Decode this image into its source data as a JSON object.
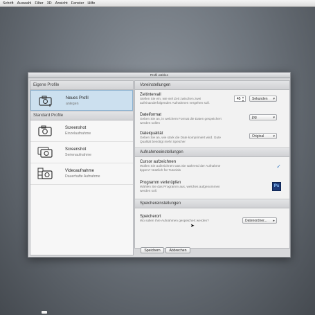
{
  "menu": [
    "Schrift",
    "Auswahl",
    "Filter",
    "3D",
    "Ansicht",
    "Fenster",
    "Hilfe"
  ],
  "dialog": {
    "title": "Profil wählen"
  },
  "left_panel": {
    "own_header": "Eigene Profile",
    "own_items": [
      {
        "title": "Neues Profil",
        "subtitle": "anlegen",
        "icon": "camera-add-icon",
        "selected": true
      }
    ],
    "standard_header": "Standard Profile",
    "standard_items": [
      {
        "title": "Screenshot",
        "subtitle": "Einzelaufnahme",
        "icon": "camera-icon"
      },
      {
        "title": "Screenshot",
        "subtitle": "Serienaufnahme",
        "icon": "camera-stack-icon"
      },
      {
        "title": "Videoaufnahme",
        "subtitle": "Dauerhafte Aufnahme",
        "icon": "video-camera-icon"
      }
    ]
  },
  "right_panel": {
    "sections": {
      "presets": "Voreinstellungen",
      "recording": "Aufnahmeeinstellungen",
      "storage": "Speichereinstellungen"
    },
    "interval": {
      "title": "Zeitintervall",
      "desc": "Stellen Sie ein, wie viel Zeit zwischen zwei aufeinanderfolgenden Aufnahmen vergehen soll.",
      "value": "45",
      "unit": "Sekunden"
    },
    "format": {
      "title": "Dateiformat",
      "desc": "Geben Sie an, in welchem Format die Daten gespeichert werden sollen",
      "value": "jpg"
    },
    "quality": {
      "title": "Dateiqualität",
      "desc": "Geben Sie an, wie stark die Date komprimiert wird. Gute Qualität benötigt mehr Speicher",
      "value": "Original"
    },
    "cursor": {
      "title": "Cursor aufzeichnen",
      "desc": "Wollen Sie aufzeichnen was Sie während der Aufnahme tippen? Nützlich für Tutorials",
      "checked": true
    },
    "link": {
      "title": "Programm verknüpfen",
      "desc": "Wählen Sie das Programm aus, welches aufgenommen werden soll.",
      "app_icon": "Ps"
    },
    "location": {
      "title": "Speicherort",
      "desc": "Wo sollen Ihre Aufnahmen gespeichert werden?",
      "value": "Datenordner..."
    }
  },
  "buttons": {
    "save": "Speichern",
    "cancel": "Abbrechen"
  },
  "colors": {
    "selected_bg": "#cce0ef",
    "check": "#3f7fc4",
    "ps_bg": "#1d3a78"
  }
}
